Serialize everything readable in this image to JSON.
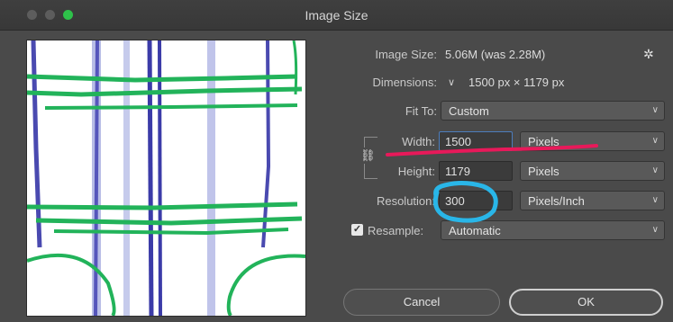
{
  "window": {
    "title": "Image Size"
  },
  "info": {
    "image_size_label": "Image Size:",
    "image_size_value": "5.06M (was 2.28M)",
    "dimensions_label": "Dimensions:",
    "dimensions_value": "1500 px  ×  1179 px",
    "gear_icon": "gear-icon"
  },
  "fit_to": {
    "label": "Fit To:",
    "value": "Custom"
  },
  "width": {
    "label": "Width:",
    "value": "1500",
    "unit": "Pixels"
  },
  "height": {
    "label": "Height:",
    "value": "1179",
    "unit": "Pixels"
  },
  "resolution": {
    "label": "Resolution:",
    "value": "300",
    "unit": "Pixels/Inch"
  },
  "resample": {
    "label": "Resample:",
    "checked": true,
    "value": "Automatic"
  },
  "buttons": {
    "cancel": "Cancel",
    "ok": "OK"
  },
  "colors": {
    "annotation_underline": "#e8195a",
    "annotation_circle": "#29b6e8",
    "sketch_green": "#22b35a",
    "sketch_blue": "#4a4ab0"
  }
}
